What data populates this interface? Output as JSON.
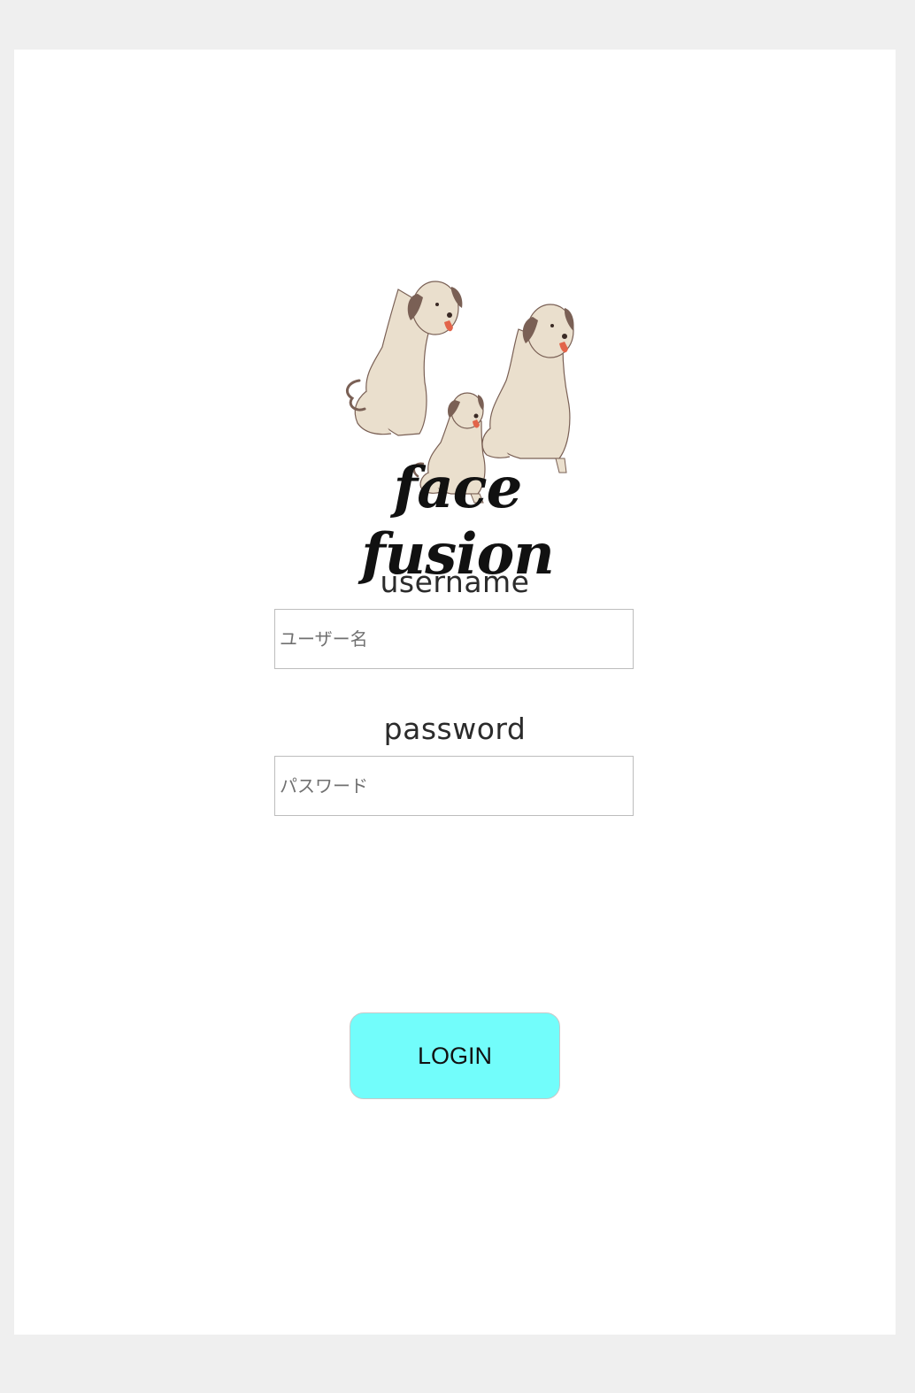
{
  "brand": {
    "logo_text": "face fusion",
    "logo_icon": "three-dogs-icon"
  },
  "form": {
    "username_label": "username",
    "username_placeholder": "ユーザー名",
    "password_label": "password",
    "password_placeholder": "パスワード",
    "login_label": "LOGIN"
  },
  "colors": {
    "page_background": "#efefef",
    "card_background": "#ffffff",
    "login_button": "#72fdfb",
    "dog_fur": "#eadfcd",
    "dog_ears": "#7a6055",
    "dog_tongue": "#e2644a"
  }
}
